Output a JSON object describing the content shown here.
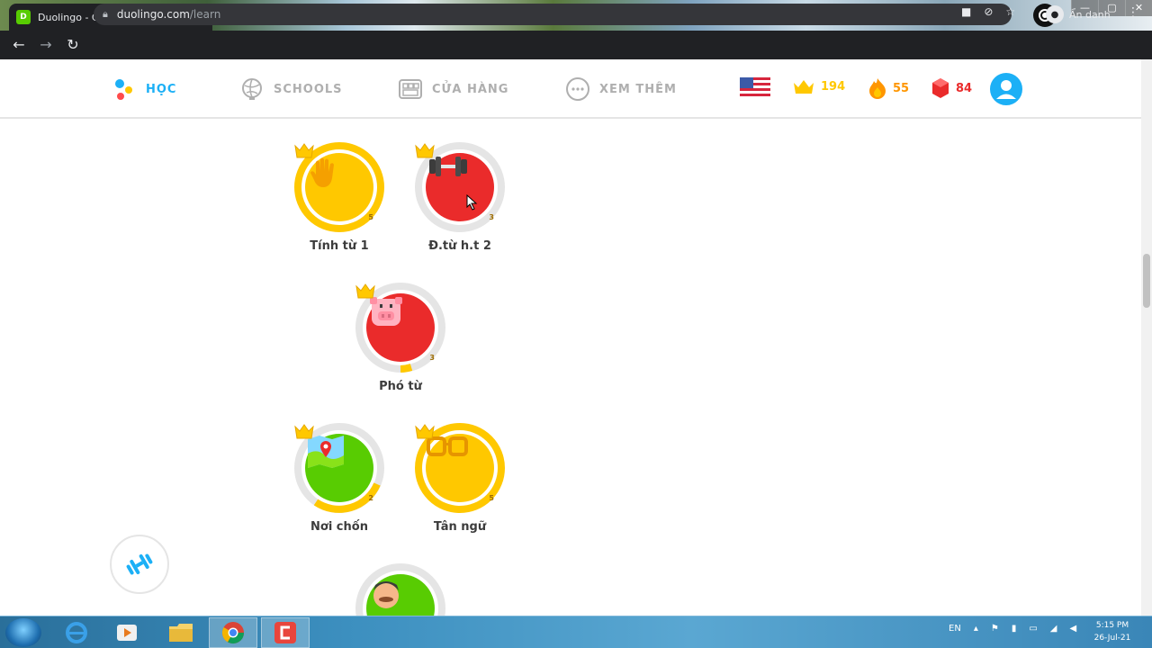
{
  "browser": {
    "tab_title": "Duolingo - Cách học Tiếng Anh",
    "tab_favicon": "duo",
    "url_host": "duolingo.com",
    "url_path": "/learn",
    "profile_label": "Ẩn danh"
  },
  "header": {
    "nav": [
      {
        "label": "HỌC",
        "icon": "home-dots-icon",
        "active": true
      },
      {
        "label": "SCHOOLS",
        "icon": "globe-icon",
        "active": false
      },
      {
        "label": "CỬA HÀNG",
        "icon": "shop-icon",
        "active": false
      },
      {
        "label": "XEM THÊM",
        "icon": "more-icon",
        "active": false
      }
    ],
    "stats": {
      "flag": "us-flag",
      "crowns": "194",
      "streak": "55",
      "gems": "84"
    }
  },
  "skills": [
    {
      "label": "Tính từ 1",
      "crown": "5",
      "color": "#ffc800",
      "icon": "hand-icon",
      "progress": 1.0
    },
    {
      "label": "Đ.từ h.t 2",
      "crown": "3",
      "color": "#ea2b2b",
      "icon": "dumbbell-icon",
      "progress": 0.0
    },
    {
      "label": "Phó từ",
      "crown": "3",
      "color": "#ea2b2b",
      "icon": "pig-icon",
      "progress": 0.1
    },
    {
      "label": "Nơi chốn",
      "crown": "2",
      "color": "#58cc02",
      "icon": "map-icon",
      "progress": 0.35
    },
    {
      "label": "Tân ngữ",
      "crown": "5",
      "color": "#ffc800",
      "icon": "glasses-icon",
      "progress": 1.0
    },
    {
      "label": "",
      "crown": "",
      "color": "#58cc02",
      "icon": "face-icon",
      "progress": 0.0
    }
  ],
  "taskbar": {
    "lang": "EN",
    "time": "5:15 PM",
    "date": "26-Jul-21"
  },
  "colors": {
    "accent_blue": "#1cb0f6",
    "gold": "#ffc800",
    "red": "#ea2b2b",
    "green": "#58cc02",
    "streak_orange": "#ff9600",
    "gem_red": "#ff4b4b"
  }
}
